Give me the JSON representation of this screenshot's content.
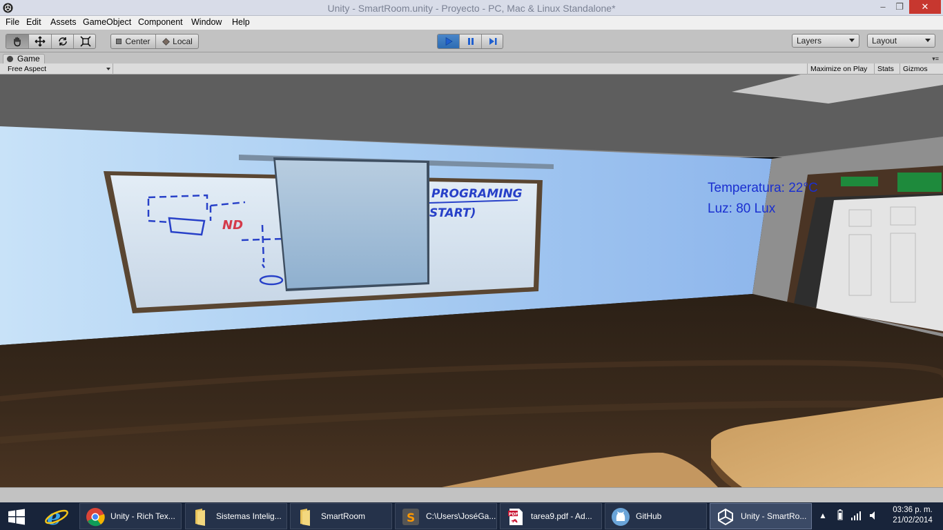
{
  "window": {
    "title": "Unity - SmartRoom.unity - Proyecto - PC, Mac & Linux Standalone*",
    "minimize": "–",
    "restore": "❐",
    "close": "✕"
  },
  "menu": [
    "File",
    "Edit",
    "Assets",
    "GameObject",
    "Component",
    "Window",
    "Help"
  ],
  "toolbar": {
    "pivot": "Center",
    "space": "Local",
    "layers": "Layers",
    "layout": "Layout"
  },
  "panel": {
    "tab": "Game",
    "aspect": "Free Aspect",
    "maximize": "Maximize on Play",
    "stats": "Stats",
    "gizmos": "Gizmos"
  },
  "hud": {
    "temperature": "Temperatura: 22°C",
    "light": "Luz: 80 Lux"
  },
  "scene_text": {
    "nd": "ND",
    "programing": "PROGRAMING",
    "start": "START)"
  },
  "taskbar": {
    "items": [
      {
        "label": "Unity - Rich Tex...",
        "icon": "chrome-icon"
      },
      {
        "label": "Sistemas Intelig...",
        "icon": "folder-icon"
      },
      {
        "label": "SmartRoom",
        "icon": "folder-icon"
      },
      {
        "label": "C:\\Users\\JoséGa...",
        "icon": "sublime-icon"
      },
      {
        "label": "tarea9.pdf - Ad...",
        "icon": "pdf-icon"
      },
      {
        "label": "GitHub",
        "icon": "github-icon"
      },
      {
        "label": "Unity - SmartRo...",
        "icon": "unity-icon"
      }
    ],
    "time": "03:36 p. m.",
    "date": "21/02/2014"
  },
  "colors": {
    "hud_text": "#1a2fd0",
    "taskbar": "#18243a",
    "close_button": "#c7372f"
  }
}
